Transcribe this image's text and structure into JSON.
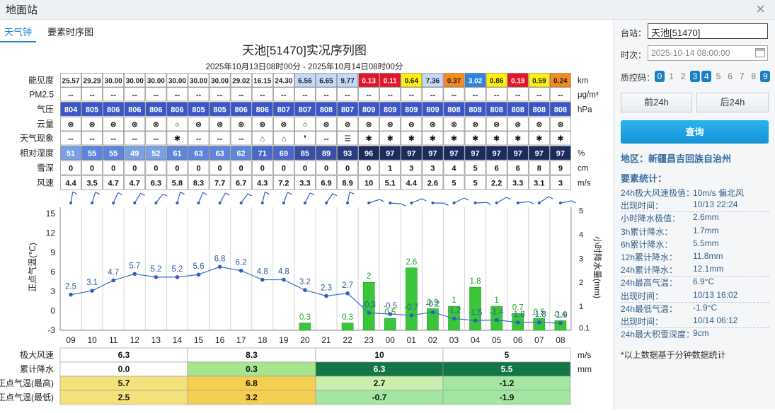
{
  "window": {
    "title": "地面站",
    "close_label": "×"
  },
  "tabs": [
    {
      "label": "天气钟",
      "active": true
    },
    {
      "label": "要素时序图",
      "active": false
    }
  ],
  "chart_header": {
    "title": "天池[51470]实况序列图",
    "subtitle": "2025年10月13日08时00分 - 2025年10月14日08时00分"
  },
  "chart_data": {
    "type": "table",
    "hours": [
      "09",
      "10",
      "11",
      "12",
      "13",
      "14",
      "15",
      "16",
      "17",
      "18",
      "19",
      "20",
      "21",
      "22",
      "23",
      "00",
      "01",
      "02",
      "03",
      "04",
      "05",
      "06",
      "07",
      "08"
    ],
    "rows": [
      {
        "label": "能见度",
        "unit": "km",
        "values": [
          "25.57",
          "29.29",
          "30.00",
          "30.00",
          "30.00",
          "30.00",
          "30.00",
          "30.00",
          "29.02",
          "16.15",
          "24.30",
          "6.56",
          "6.65",
          "9.77",
          "0.13",
          "0.11",
          "0.64",
          "7.36",
          "0.37",
          "3.02",
          "0.86",
          "0.19",
          "0.59",
          "0.24"
        ]
      },
      {
        "label": "PM2.5",
        "unit": "μg/m³",
        "values": [
          "--",
          "--",
          "--",
          "--",
          "--",
          "--",
          "--",
          "--",
          "--",
          "--",
          "--",
          "--",
          "--",
          "--",
          "--",
          "--",
          "--",
          "--",
          "--",
          "--",
          "--",
          "--",
          "--",
          "--"
        ]
      },
      {
        "label": "气压",
        "unit": "hPa",
        "values": [
          "804",
          "805",
          "806",
          "806",
          "806",
          "806",
          "805",
          "805",
          "806",
          "806",
          "807",
          "807",
          "808",
          "807",
          "809",
          "809",
          "809",
          "809",
          "808",
          "808",
          "808",
          "808",
          "808",
          "808"
        ]
      },
      {
        "label": "云量",
        "unit": "",
        "values": [
          "⊗",
          "⊗",
          "⊗",
          "⊗",
          "⊗",
          "○",
          "⊗",
          "⊗",
          "⊗",
          "⊗",
          "⊗",
          "○",
          "⊗",
          "⊗",
          "⊗",
          "⊗",
          "⊗",
          "⊗",
          "⊗",
          "⊗",
          "⊗",
          "⊗",
          "⊗",
          "⊗"
        ]
      },
      {
        "label": "天气现象",
        "unit": "",
        "values": [
          "--",
          "--",
          "--",
          "--",
          "--",
          "✱",
          "--",
          "--",
          "--",
          "⌂",
          "⌂",
          "❜",
          "--",
          "☰",
          "✱",
          "✱",
          "✱",
          "✱",
          "✱",
          "✱",
          "✱",
          "✱",
          "✱",
          "✱"
        ]
      },
      {
        "label": "相对湿度",
        "unit": "%",
        "values": [
          "51",
          "55",
          "55",
          "49",
          "52",
          "61",
          "63",
          "63",
          "62",
          "71",
          "69",
          "85",
          "89",
          "93",
          "96",
          "97",
          "97",
          "97",
          "97",
          "97",
          "97",
          "97",
          "97",
          "97"
        ]
      },
      {
        "label": "雪深",
        "unit": "cm",
        "values": [
          "0",
          "0",
          "0",
          "0",
          "0",
          "0",
          "0",
          "0",
          "0",
          "0",
          "0",
          "0",
          "0",
          "0",
          "0",
          "1",
          "3",
          "3",
          "4",
          "5",
          "6",
          "6",
          "8",
          "9"
        ]
      },
      {
        "label": "风速",
        "unit": "m/s",
        "values": [
          "4.4",
          "3.5",
          "4.7",
          "4.7",
          "6.3",
          "5.8",
          "8.3",
          "7.7",
          "6.7",
          "4.3",
          "7.2",
          "3.3",
          "6.9",
          "8.9",
          "10",
          "5.1",
          "4.4",
          "2.6",
          "5",
          "5",
          "2.2",
          "3.3",
          "3.1",
          "3"
        ]
      }
    ],
    "series": [
      {
        "name": "正点气温(℃)",
        "values": [
          2.5,
          3.1,
          4.7,
          5.7,
          5.2,
          5.2,
          5.6,
          6.8,
          6.2,
          4.8,
          4.8,
          3.2,
          2.3,
          2.7,
          -0.3,
          -0.5,
          -0.7,
          -0.2,
          -1.2,
          -1.5,
          -1.4,
          -1.8,
          -1.8,
          -1.9
        ]
      },
      {
        "name": "小时降水量(mm)",
        "values": [
          0,
          0,
          0,
          0,
          0,
          0,
          0,
          0,
          0,
          0,
          0,
          0.3,
          0,
          0.3,
          2,
          0.5,
          2.6,
          0.9,
          1,
          1.8,
          1,
          0.7,
          0.5,
          0.4
        ]
      }
    ],
    "y_left": {
      "label": "正点气温(℃)",
      "ticks": [
        15,
        12,
        9,
        6,
        3,
        0,
        -3
      ],
      "range": [
        -3,
        16
      ]
    },
    "y_right": {
      "label": "小时降水量(mm)",
      "ticks": [
        5,
        4,
        3,
        2,
        1,
        0.1
      ],
      "range": [
        0.1,
        5
      ]
    },
    "summary": [
      {
        "label": "极大风速",
        "unit": "m/s",
        "values": [
          "6.3",
          "8.3",
          "10",
          "5"
        ]
      },
      {
        "label": "累计降水",
        "unit": "mm",
        "values": [
          "0.0",
          "0.3",
          "6.3",
          "5.5"
        ]
      },
      {
        "label": "正点气温(最高)",
        "unit": "",
        "values": [
          "5.7",
          "6.8",
          "2.7",
          "-1.2"
        ]
      },
      {
        "label": "正点气温(最低)",
        "unit": "",
        "values": [
          "2.5",
          "3.2",
          "-0.7",
          "-1.9"
        ]
      }
    ]
  },
  "colors": {
    "accent": "#1a86d3",
    "pressure": "#3b56c8",
    "humidity_dark": "#1c2a5c",
    "temp_line": "#3a6fc9",
    "precip": "#2ec12e"
  },
  "form": {
    "station_label": "台站：",
    "station_value": "天池[51470]",
    "time_label": "时次：",
    "time_value": "2025-10-14 08:00:00",
    "qc_label": "质控码：",
    "qc_codes": [
      "0",
      "1",
      "2",
      "3",
      "4",
      "5",
      "6",
      "7",
      "8",
      "9"
    ],
    "prev_label": "前24h",
    "next_label": "后24h",
    "query_label": "查询"
  },
  "region": "地区：新疆昌吉回族自治州",
  "stats": {
    "title": "要素统计：",
    "rows": [
      {
        "k": "24h极大风速极值：",
        "v": "10m/s 偏北风"
      },
      {
        "k": "出现时间：",
        "v": "10/13 22:24"
      },
      {
        "k": "小时降水极值：",
        "v": "2.6mm"
      },
      {
        "k": "3h累计降水：",
        "v": "1.7mm"
      },
      {
        "k": "6h累计降水：",
        "v": "5.5mm"
      },
      {
        "k": "12h累计降水：",
        "v": "11.8mm"
      },
      {
        "k": "24h累计降水：",
        "v": "12.1mm"
      },
      {
        "k": "24h最高气温：",
        "v": "6.9°C"
      },
      {
        "k": "出现时间：",
        "v": "10/13 16:02"
      },
      {
        "k": "24h最低气温：",
        "v": "-1.9°C"
      },
      {
        "k": "出现时间：",
        "v": "10/14 06:12"
      },
      {
        "k": "24h最大积雪深度：",
        "v": "9cm"
      }
    ],
    "note": "*以上数据基于分钟数据统计"
  }
}
